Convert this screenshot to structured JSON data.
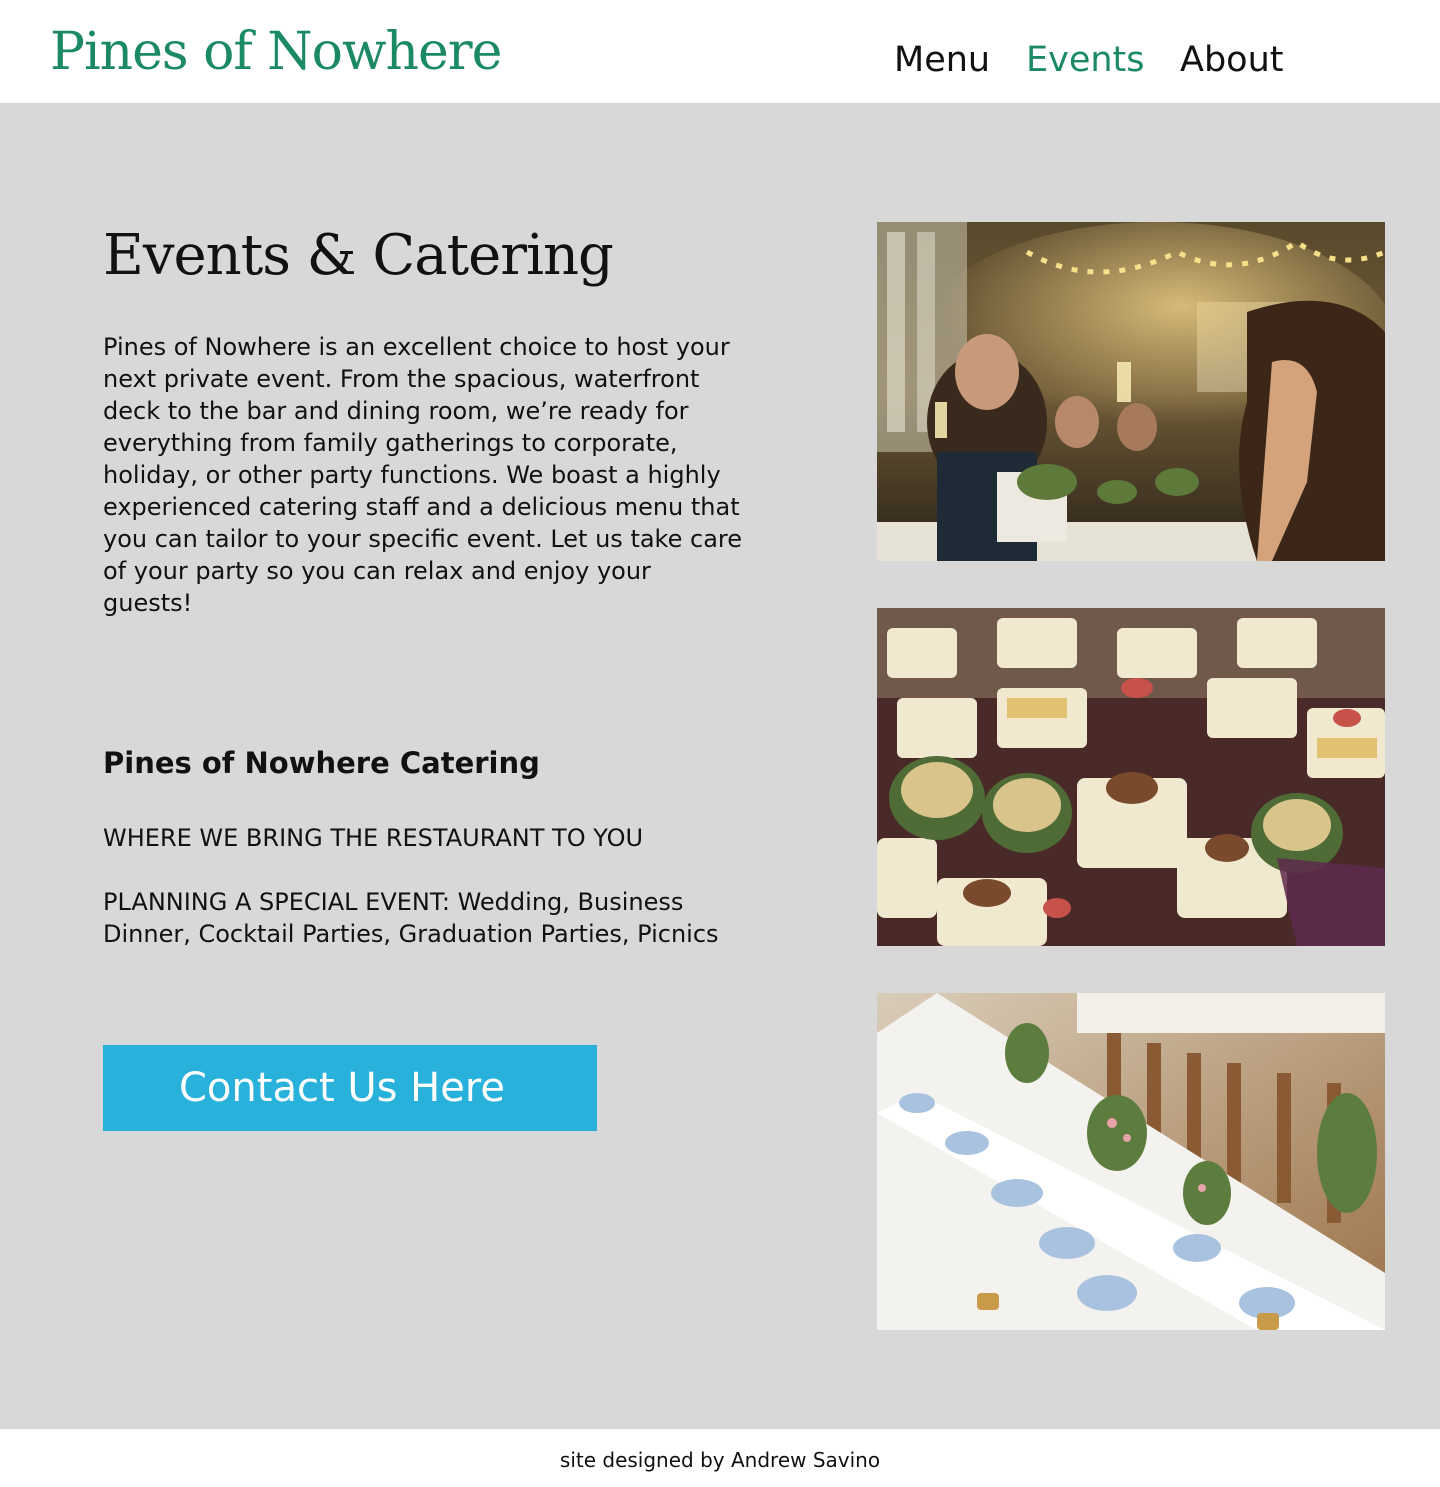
{
  "header": {
    "brand": "Pines of Nowhere",
    "nav": [
      {
        "label": "Menu",
        "active": false
      },
      {
        "label": "Events",
        "active": true
      },
      {
        "label": "About",
        "active": false
      }
    ]
  },
  "main": {
    "title": "Events & Catering",
    "intro": "Pines of Nowhere is an excellent choice to host your next private event. From the spacious, waterfront deck to the bar and dining room, we’re ready for everything from family gatherings to corporate, holiday, or other party functions. We boast a highly experienced catering staff and a delicious menu that you can tailor to your specific event. Let us take care of your party so you can relax and enjoy your guests!",
    "catering_heading": "Pines of Nowhere Catering",
    "tagline": "WHERE WE BRING THE RESTAURANT TO YOU",
    "planning": "PLANNING A SPECIAL EVENT: Wedding, Business Dinner, Cocktail Parties, Graduation Parties, Picnics",
    "cta_label": "Contact Us Here"
  },
  "photos": [
    {
      "name": "event-toast-photo"
    },
    {
      "name": "catering-appetizers-photo"
    },
    {
      "name": "banquet-table-photo"
    }
  ],
  "footer": {
    "credit": "site designed by Andrew Savino"
  },
  "colors": {
    "brand_green": "#1b8a64",
    "cta_blue": "#27b1db",
    "content_background": "#d8d8d8",
    "text": "#111111"
  }
}
